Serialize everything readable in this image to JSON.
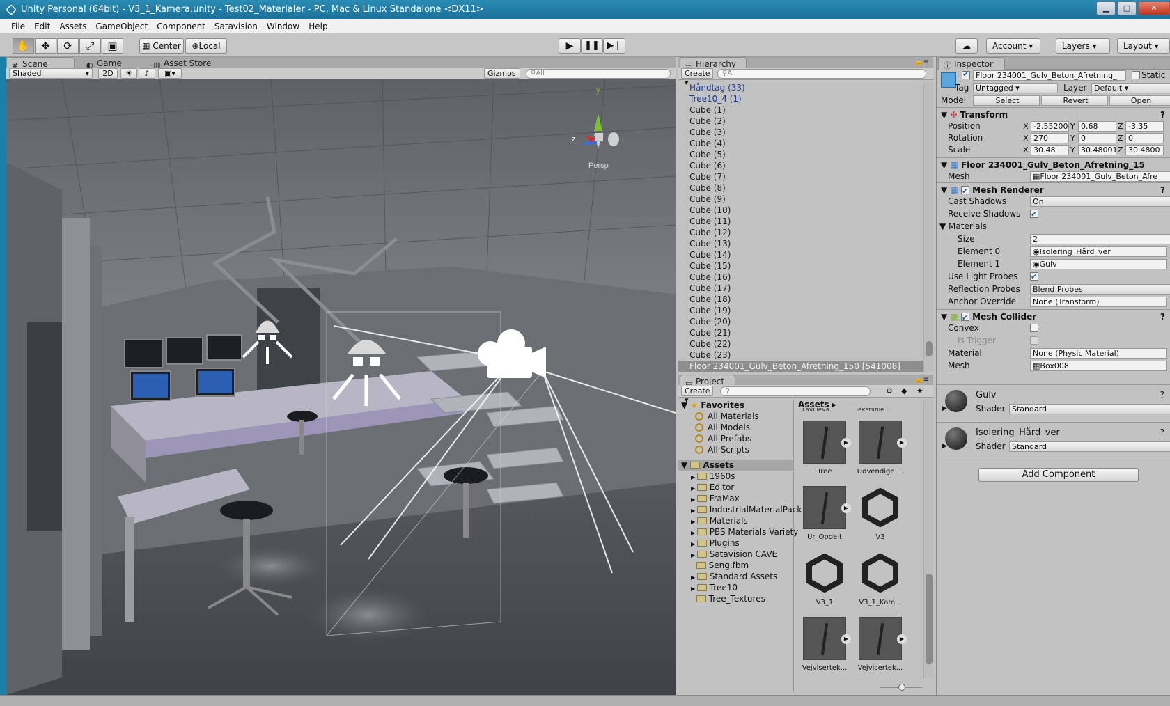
{
  "window": {
    "title": "Unity Personal (64bit) - V3_1_Kamera.unity - Test02_Materialer - PC, Mac & Linux Standalone <DX11>",
    "min": "▁",
    "max": "□",
    "close": "✕"
  },
  "menu": [
    "File",
    "Edit",
    "Assets",
    "GameObject",
    "Component",
    "Satavision",
    "Window",
    "Help"
  ],
  "toolbar": {
    "center": "Center",
    "local": "Local",
    "account": "Account",
    "layers": "Layers",
    "layout": "Layout"
  },
  "scene": {
    "tabs": {
      "scene": "Scene",
      "game": "Game",
      "asset_store": "Asset Store"
    },
    "shading": "Shaded",
    "mode_2d": "2D",
    "gizmos": "Gizmos",
    "search_placeholder": "All",
    "persp": "Persp",
    "axis_x": "z",
    "axis_y": "y"
  },
  "hierarchy": {
    "tab": "Hierarchy",
    "create": "Create",
    "search_placeholder": "All",
    "items": [
      "Håndtag (33)",
      "Tree10_4 (1)",
      "Cube (1)",
      "Cube (2)",
      "Cube (3)",
      "Cube (4)",
      "Cube (5)",
      "Cube (6)",
      "Cube (7)",
      "Cube (8)",
      "Cube (9)",
      "Cube (10)",
      "Cube (11)",
      "Cube (12)",
      "Cube (13)",
      "Cube (14)",
      "Cube (15)",
      "Cube (16)",
      "Cube (17)",
      "Cube (18)",
      "Cube (19)",
      "Cube (20)",
      "Cube (21)",
      "Cube (22)",
      "Cube (23)"
    ],
    "selected": "Floor 234001_Gulv_Beton_Afretning_150 [541008]"
  },
  "project": {
    "tab": "Project",
    "create": "Create",
    "breadcrumb": "Assets",
    "favorites_label": "Favorites",
    "favorites": [
      "All Materials",
      "All Models",
      "All Prefabs",
      "All Scripts"
    ],
    "assets_label": "Assets",
    "folders": [
      "1960s",
      "Editor",
      "FraMax",
      "IndustrialMaterialPack",
      "Materials",
      "PBS Materials Variety",
      "Plugins",
      "Satavision CAVE",
      "Seng.fbm",
      "Standard Assets",
      "Tree10",
      "Tree_Textures"
    ],
    "grid_cut_labels": [
      "FavLleva...",
      "Tekstilfile..."
    ],
    "grid": [
      "Tree",
      "Udvendige ...",
      "Ur_Opdelt",
      "V3",
      "V3_1",
      "V3_1_Kam...",
      "Vejvisertek...",
      "Vejvisertek..."
    ]
  },
  "inspector": {
    "tab": "Inspector",
    "object_name": "Floor 234001_Gulv_Beton_Afretning_",
    "static": "Static",
    "tag_label": "Tag",
    "tag": "Untagged",
    "layer_label": "Layer",
    "layer": "Default",
    "model_label": "Model",
    "select": "Select",
    "revert": "Revert",
    "open": "Open",
    "transform": {
      "title": "Transform",
      "position_label": "Position",
      "rotation_label": "Rotation",
      "scale_label": "Scale",
      "position": [
        "-2.55200",
        "0.68",
        "-3.35"
      ],
      "rotation": [
        "270",
        "0",
        "0"
      ],
      "scale": [
        "30.48",
        "30.48001",
        "30.4800"
      ]
    },
    "mesh_filter": {
      "title": "Floor 234001_Gulv_Beton_Afretning_15",
      "mesh_label": "Mesh",
      "mesh": "Floor 234001_Gulv_Beton_Afre"
    },
    "mesh_renderer": {
      "title": "Mesh Renderer",
      "cast_shadows_label": "Cast Shadows",
      "cast_shadows": "On",
      "receive_shadows_label": "Receive Shadows",
      "materials_label": "Materials",
      "size_label": "Size",
      "size": "2",
      "element0_label": "Element 0",
      "element0": "Isolering_Hård_ver",
      "element1_label": "Element 1",
      "element1": "Gulv",
      "light_probes_label": "Use Light Probes",
      "reflection_probes_label": "Reflection Probes",
      "reflection_probes": "Blend Probes",
      "anchor_label": "Anchor Override",
      "anchor": "None (Transform)"
    },
    "mesh_collider": {
      "title": "Mesh Collider",
      "convex_label": "Convex",
      "trigger_label": "Is Trigger",
      "material_label": "Material",
      "material": "None (Physic Material)",
      "mesh_label": "Mesh",
      "mesh": "Box008"
    },
    "mat1": {
      "name": "Gulv",
      "shader_label": "Shader",
      "shader": "Standard"
    },
    "mat2": {
      "name": "Isolering_Hård_ver",
      "shader_label": "Shader",
      "shader": "Standard"
    },
    "add_component": "Add Component"
  }
}
